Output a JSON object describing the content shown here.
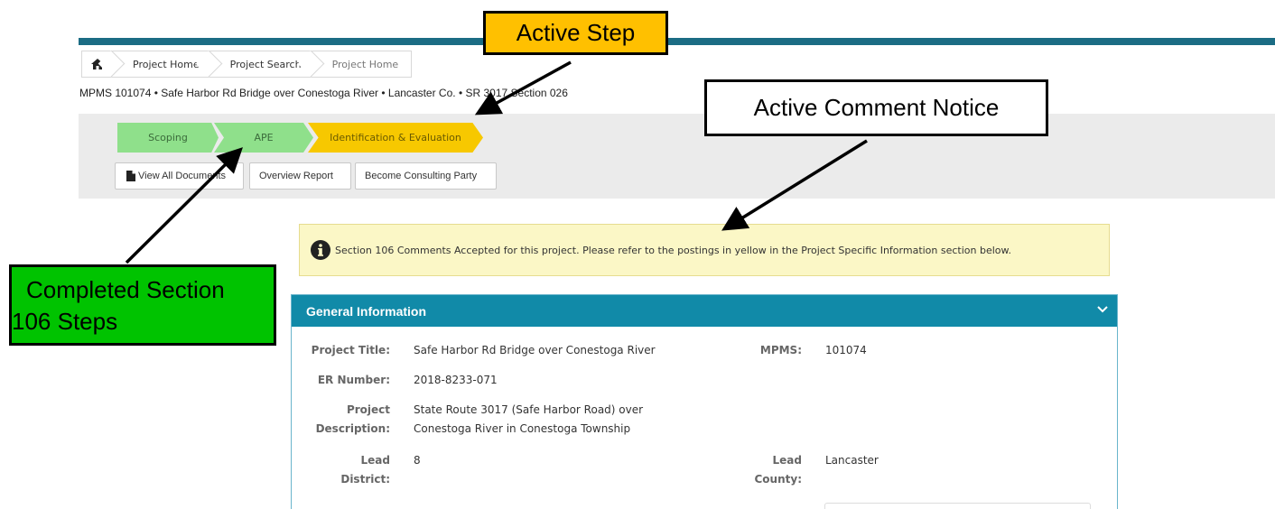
{
  "breadcrumb": {
    "home_icon": "home-icon",
    "items": [
      "Project Home",
      "Project Search",
      "Project Home"
    ]
  },
  "project_line": "MPMS 101074 • Safe Harbor Rd Bridge over Conestoga River • Lancaster Co. • SR 3017 Section 026",
  "steps": {
    "items": [
      {
        "label": "Scoping",
        "status": "completed"
      },
      {
        "label": "APE",
        "status": "completed"
      },
      {
        "label": "Identification & Evaluation",
        "status": "active"
      }
    ],
    "colors": {
      "completed": "#8fe08b",
      "active": "#f7c800"
    }
  },
  "actions": {
    "view_docs": "View All Documents",
    "overview": "Overview Report",
    "consulting": "Become Consulting Party"
  },
  "comment_notice": {
    "icon": "info-icon",
    "text": "Section 106 Comments Accepted for this project. Please refer to the postings in yellow in the Project Specific Information section below."
  },
  "general_info": {
    "title": "General Information",
    "project_title_label": "Project Title:",
    "project_title": "Safe Harbor Rd Bridge over Conestoga River",
    "mpms_label": "MPMS:",
    "mpms": "101074",
    "er_label": "ER Number:",
    "er": "2018-8233-071",
    "desc_label_1": "Project",
    "desc_label_2": "Description:",
    "desc_1": "State Route 3017 (Safe Harbor Road) over",
    "desc_2": "Conestoga River in Conestoga Township",
    "district_label_1": "Lead",
    "district_label_2": "District:",
    "district": "8",
    "county_label_1": "Lead",
    "county_label_2": "County:",
    "county": "Lancaster"
  },
  "annotations": {
    "active_step": "Active Step",
    "active_comment": "Active Comment Notice",
    "completed_1": "Completed Section",
    "completed_2": "106 Steps"
  },
  "colors": {
    "header_teal": "#118aa8",
    "top_bar": "#1b6c84",
    "notice_bg": "#fbf7c6",
    "callout_orange": "#ffc000",
    "callout_green": "#00c300"
  }
}
